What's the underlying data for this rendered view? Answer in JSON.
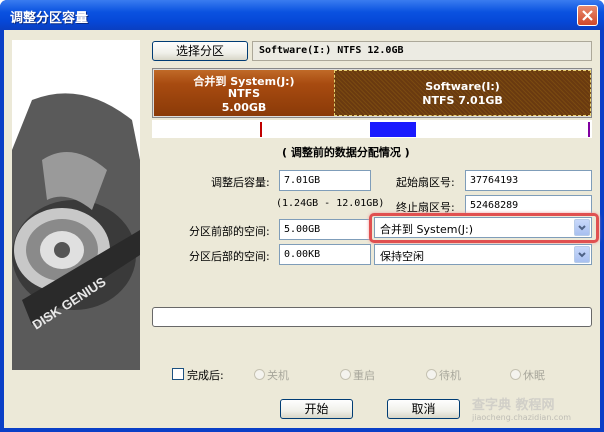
{
  "window": {
    "title": "调整分区容量"
  },
  "header": {
    "select_button": "选择分区",
    "partition_info": "Software(I:) NTFS 12.0GB"
  },
  "disk_bar": {
    "left": {
      "name": "合并到 System(J:)",
      "fs": "NTFS",
      "size": "5.00GB"
    },
    "right": {
      "name": "Software(I:)",
      "fs": "NTFS 7.01GB"
    }
  },
  "caption": "( 调整前的数据分配情况 )",
  "form": {
    "size_after_label": "调整后容量:",
    "size_after_value": "7.01GB",
    "range_text": "(1.24GB - 12.01GB)",
    "start_sector_label": "起始扇区号:",
    "start_sector_value": "37764193",
    "end_sector_label": "终止扇区号:",
    "end_sector_value": "52468289",
    "before_space_label": "分区前部的空间:",
    "before_space_value": "5.00GB",
    "before_space_option": "合并到 System(J:)",
    "after_space_label": "分区后部的空间:",
    "after_space_value": "0.00KB",
    "after_space_option": "保持空闲"
  },
  "completion": {
    "checkbox_label": "完成后:",
    "options": [
      "关机",
      "重启",
      "待机",
      "休眠"
    ]
  },
  "buttons": {
    "start": "开始",
    "cancel": "取消"
  },
  "side_image": {
    "brand": "DISK GENIUS"
  },
  "watermark": {
    "site": "查字典 教程网",
    "url": "jiaocheng.chazidian.com"
  },
  "colors": {
    "partition_left": "#a84b10",
    "partition_right": "#6a3a10",
    "highlight": "#e05050"
  }
}
